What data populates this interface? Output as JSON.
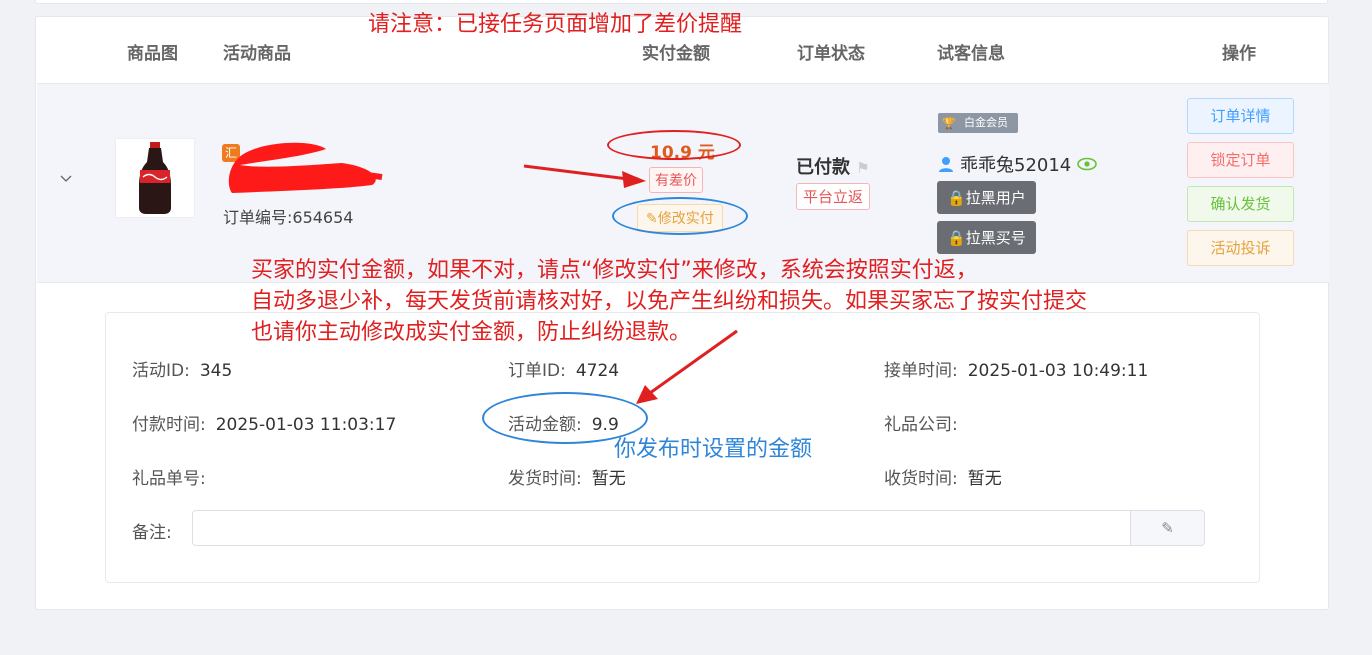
{
  "table": {
    "headers": [
      "商品图",
      "活动商品",
      "实付金额",
      "订单状态",
      "试客信息",
      "操作"
    ]
  },
  "order": {
    "brand_tag": "汇",
    "order_no": "订单编号:654654",
    "price": "10.9 元",
    "diff_tag": "有差价",
    "modify_label": "修改实付",
    "status": "已付款",
    "platform_tag": "平台立返",
    "member_badge": "白金会员",
    "username": "乖乖兔52014",
    "blacklist_user": "拉黑用户",
    "blacklist_account": "拉黑买号"
  },
  "actions": [
    "订单详情",
    "锁定订单",
    "确认发货",
    "活动投诉"
  ],
  "details": {
    "activity_id_label": "活动ID:",
    "activity_id": "345",
    "order_id_label": "订单ID:",
    "order_id": "4724",
    "accept_time_label": "接单时间:",
    "accept_time": "2025-01-03 10:49:11",
    "pay_time_label": "付款时间:",
    "pay_time": "2025-01-03 11:03:17",
    "amount_label": "活动金额:",
    "amount": "9.9",
    "gift_company_label": "礼品公司:",
    "gift_company": "",
    "gift_no_label": "礼品单号:",
    "gift_no": "",
    "ship_time_label": "发货时间:",
    "ship_time": "暂无",
    "receive_time_label": "收货时间:",
    "receive_time": "暂无",
    "remark_label": "备注:"
  },
  "annotations": {
    "top_note": "请注意：已接任务页面增加了差价提醒",
    "line1": "买家的实付金额，如果不对，请点“修改实付”来修改，系统会按照实付返，",
    "line2": "自动多退少补，每天发货前请核对好，以免产生纠纷和损失。如果买家忘了按实付提交",
    "line3": "也请你主动修改成实付金额，防止纠纷退款。",
    "blue_note": "你发布时设置的金额"
  },
  "colors": {
    "annotation_red": "#e02020",
    "annotation_blue": "#2f86d8",
    "price_orange": "#e05a1b"
  }
}
